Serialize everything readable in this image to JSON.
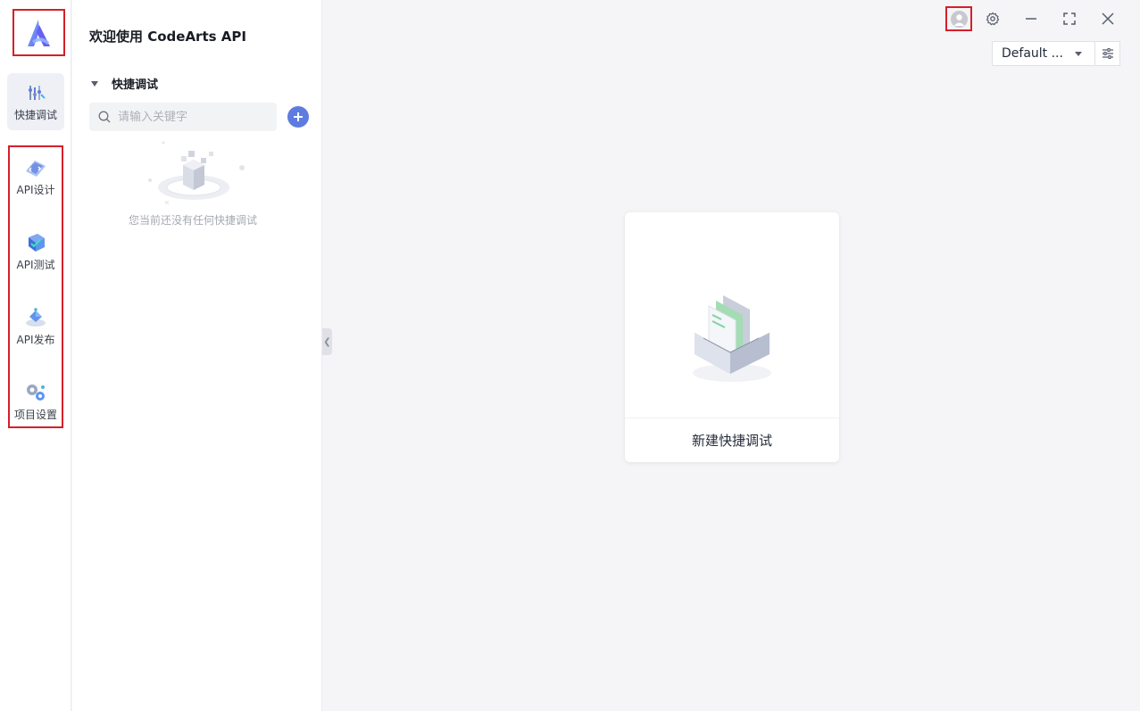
{
  "rail": {
    "items": [
      {
        "label": "快捷调试",
        "icon": "quick-debug-icon"
      },
      {
        "label": "API设计",
        "icon": "api-design-icon"
      },
      {
        "label": "API测试",
        "icon": "api-test-icon"
      },
      {
        "label": "API发布",
        "icon": "api-publish-icon"
      },
      {
        "label": "项目设置",
        "icon": "project-settings-icon"
      }
    ]
  },
  "panel": {
    "title": "欢迎使用 CodeArts API",
    "section_label": "快捷调试",
    "search_placeholder": "请输入关键字",
    "empty_text": "您当前还没有任何快捷调试"
  },
  "main": {
    "env_select_value": "Default ...",
    "card_label": "新建快捷调试"
  },
  "colors": {
    "accent": "#5e7ce0",
    "highlight_outline": "#d4202a"
  }
}
